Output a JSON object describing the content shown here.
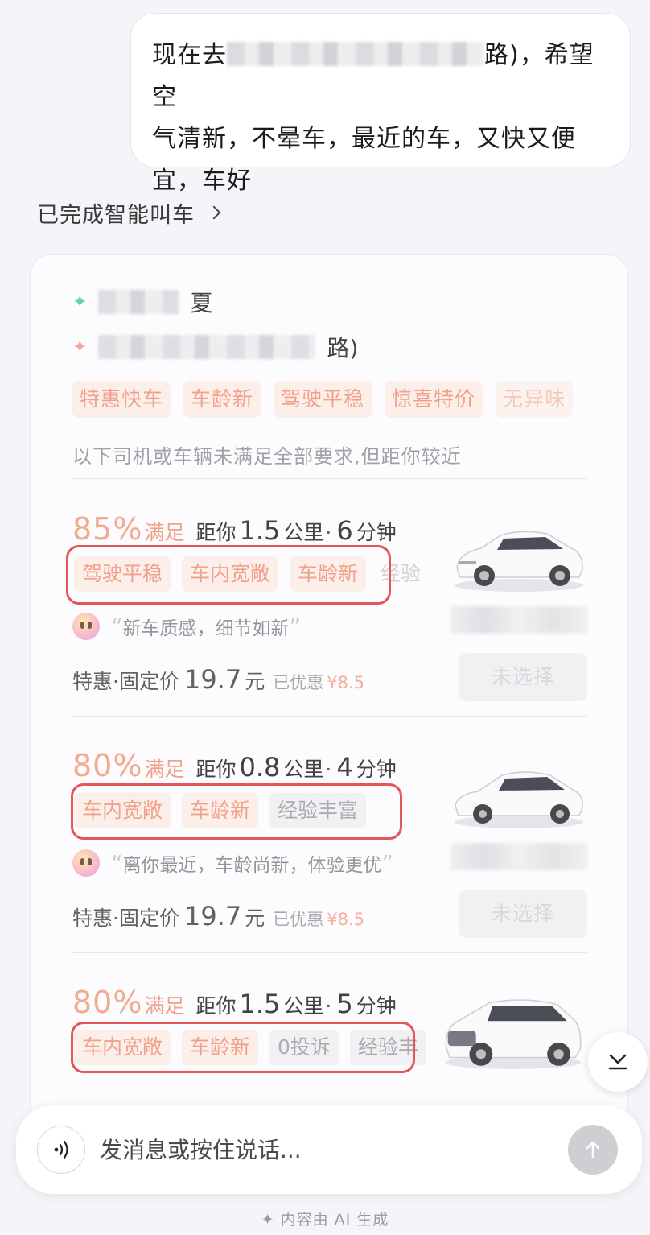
{
  "user_message": {
    "part1": "现在去",
    "part2": "路)，希望空",
    "line2": "气清新，不晕车，最近的车，又快又便",
    "line3": "宜，车好"
  },
  "status": {
    "label": "已完成智能叫车"
  },
  "route": {
    "start_suffix": "夏",
    "end_suffix": "路)"
  },
  "preference_tags": [
    "特惠快车",
    "车龄新",
    "驾驶平稳",
    "惊喜特价",
    "无异味"
  ],
  "notice": "以下司机或车辆未满足全部要求,但距你较近",
  "drivers": [
    {
      "match_pct": "85%",
      "match_label": "满足",
      "dist_label": "距你",
      "dist": "1.5",
      "dist_unit": "公里",
      "eta": "6",
      "eta_unit": "分钟",
      "tags": [
        "驾驶平稳",
        "车内宽敞",
        "车龄新",
        "经验"
      ],
      "quote": "新车质感，细节如新",
      "price_label": "特惠·固定价",
      "price": "19.7",
      "price_unit": "元",
      "discount_label": "已优惠",
      "discount": "¥8.5",
      "select_label": "未选择"
    },
    {
      "match_pct": "80%",
      "match_label": "满足",
      "dist_label": "距你",
      "dist": "0.8",
      "dist_unit": "公里",
      "eta": "4",
      "eta_unit": "分钟",
      "tags": [
        "车内宽敞",
        "车龄新",
        "经验丰富"
      ],
      "quote": "离你最近，车龄尚新，体验更优",
      "price_label": "特惠·固定价",
      "price": "19.7",
      "price_unit": "元",
      "discount_label": "已优惠",
      "discount": "¥8.5",
      "select_label": "未选择"
    },
    {
      "match_pct": "80%",
      "match_label": "满足",
      "dist_label": "距你",
      "dist": "1.5",
      "dist_unit": "公里",
      "eta": "5",
      "eta_unit": "分钟",
      "tags": [
        "车内宽敞",
        "车龄新",
        "0投诉",
        "经验丰"
      ]
    }
  ],
  "input": {
    "placeholder": "发消息或按住说话..."
  },
  "footer": "✦ 内容由 AI 生成",
  "colors": {
    "accent": "#f19a80",
    "highlight_outline": "#e34a4a"
  }
}
